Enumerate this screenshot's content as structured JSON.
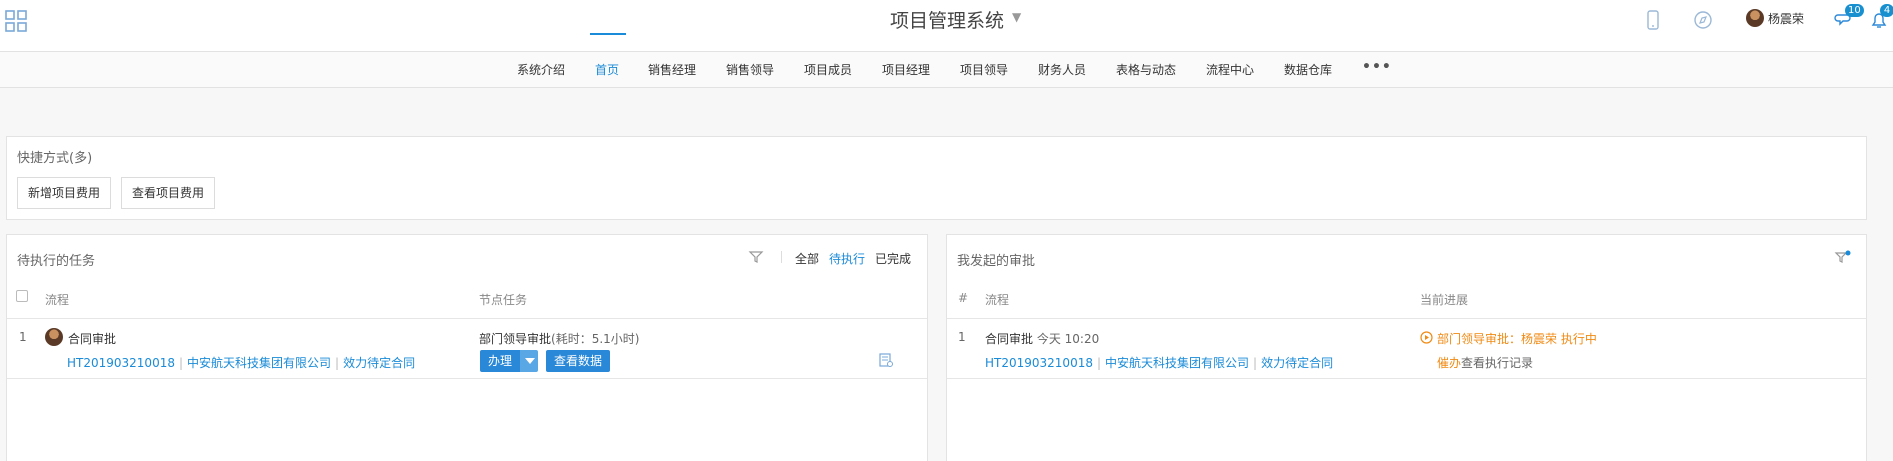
{
  "header": {
    "app_title": "项目管理系统",
    "username": "杨震荣",
    "messages_badge": "10",
    "notifications_badge": "4"
  },
  "nav": {
    "items": [
      "系统介绍",
      "首页",
      "销售经理",
      "销售领导",
      "项目成员",
      "项目经理",
      "项目领导",
      "财务人员",
      "表格与动态",
      "流程中心",
      "数据仓库"
    ],
    "active": "首页",
    "more": "•••"
  },
  "shortcuts": {
    "title": "快捷方式(多)",
    "buttons": [
      "新增项目费用",
      "查看项目费用"
    ]
  },
  "tasks": {
    "title": "待执行的任务",
    "filters": [
      "全部",
      "待执行",
      "已完成"
    ],
    "selected_filter": "待执行",
    "columns": [
      "流程",
      "节点任务"
    ],
    "rows": [
      {
        "index": "1",
        "name": "合同审批",
        "code": "HT201903210018",
        "company": "中安航天科技集团有限公司",
        "status": "效力待定合同",
        "node": "部门领导审批",
        "duration": "(耗时：5.1小时)",
        "action_label": "办理",
        "view_label": "查看数据"
      }
    ]
  },
  "approvals": {
    "title": "我发起的审批",
    "columns": [
      "#",
      "流程",
      "当前进展"
    ],
    "rows": [
      {
        "index": "1",
        "name": "合同审批",
        "time": "今天 10:20",
        "code": "HT201903210018",
        "company": "中安航天科技集团有限公司",
        "status": "效力待定合同",
        "progress": "部门领导审批：杨震荣 执行中",
        "urge_label": "催办",
        "history_label": "查看执行记录"
      }
    ]
  },
  "colors": {
    "accent": "#1a8bd8",
    "in_progress": "#f08a13"
  }
}
